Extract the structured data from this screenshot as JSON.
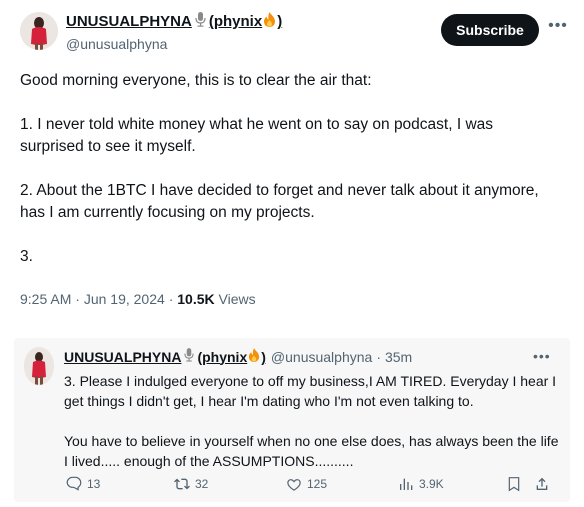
{
  "tweet": {
    "display_name": "UNUSUALPHYNA",
    "name_suffix_open": "(phynix",
    "name_suffix_close": ")",
    "handle": "@unusualphyna",
    "subscribe_label": "Subscribe",
    "paragraphs": [
      "Good morning everyone, this is to clear the air that:",
      "1. I never told white money what he went on to say on podcast, I was surprised to see it myself.",
      "2. About the 1BTC I have decided to forget and never talk about it anymore, has I am currently focusing on my projects.",
      "3."
    ],
    "time": "9:25 AM",
    "date": "Jun 19, 2024",
    "views_count": "10.5K",
    "views_label": "Views"
  },
  "quoted": {
    "display_name": "UNUSUALPHYNA",
    "name_suffix_open": "(phynix",
    "name_suffix_close": ")",
    "handle": "@unusualphyna",
    "time": "35m",
    "paragraphs": [
      "3. Please I indulged everyone to off my business,I AM TIRED. Everyday I hear I get things I didn't get, I hear I'm dating who I'm not even talking to.",
      "You have to believe in yourself when no one else does, has always been the life I lived..... enough of the ASSUMPTIONS.........."
    ],
    "actions": {
      "replies": "13",
      "reposts": "32",
      "likes": "125",
      "views": "3.9K"
    }
  },
  "separators": {
    "dot": "·"
  },
  "icons": [
    "microphone-icon",
    "fire-icon",
    "more-icon",
    "reply-icon",
    "repost-icon",
    "like-icon",
    "views-icon",
    "bookmark-icon",
    "share-icon"
  ],
  "colors": {
    "text": "#0f1419",
    "muted": "#536471",
    "quote_bg": "#f7f7f7",
    "button_bg": "#0f1419",
    "fire": "#f4900c"
  }
}
